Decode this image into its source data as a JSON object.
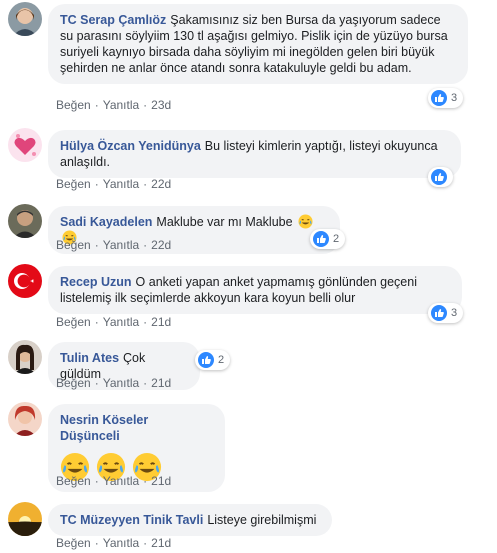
{
  "actions": {
    "like": "Beğen",
    "reply": "Yanıtla",
    "sep": "·"
  },
  "emoji_names": [
    "tears-of-joy-icon"
  ],
  "colors": {
    "author": "#385898",
    "bubble": "#f2f3f5",
    "like_badge": "#2d88ff",
    "meta": "#606770"
  },
  "comments": [
    {
      "author": "TC Serap Çamlıöz",
      "text": "Şakamısınız siz ben Bursa da yaşıyorum sadece su parasını söylyiim 130 tl aşağısı gelmiyo. Pislik için de yüzüyo bursa suriyeli kaynıyo birsada daha söyliyim mi inegölden gelen biri büyük şehirden ne anlar önce atandı sonra katakuluyle geldi bu adam.",
      "time": "23d",
      "reactions": "3"
    },
    {
      "author": "Hülya Özcan Yenidünya",
      "text": "Bu listeyi kimlerin yaptığı, listeyi okuyunca anlaşıldı.",
      "time": "22d",
      "reactions": ""
    },
    {
      "author": "Sadi Kayadelen",
      "text": "Maklube var mı Maklube",
      "time": "22d",
      "reactions": "2"
    },
    {
      "author": "Recep Uzun",
      "text": "O anketi yapan anket yapmamış gönlünden geçeni listelemiş ilk seçimlerde akkoyun kara koyun belli olur",
      "time": "21d",
      "reactions": "3"
    },
    {
      "author": "Tulin Ates",
      "text": "Çok güldüm",
      "time": "21d",
      "reactions": "2"
    },
    {
      "author": "Nesrin Köseler Düşünceli",
      "text": "",
      "time": "21d",
      "reactions": ""
    },
    {
      "author": "TC Müzeyyen Tinik Tavli",
      "text": "Listeye girebilmişmi",
      "time": "21d",
      "reactions": ""
    }
  ]
}
